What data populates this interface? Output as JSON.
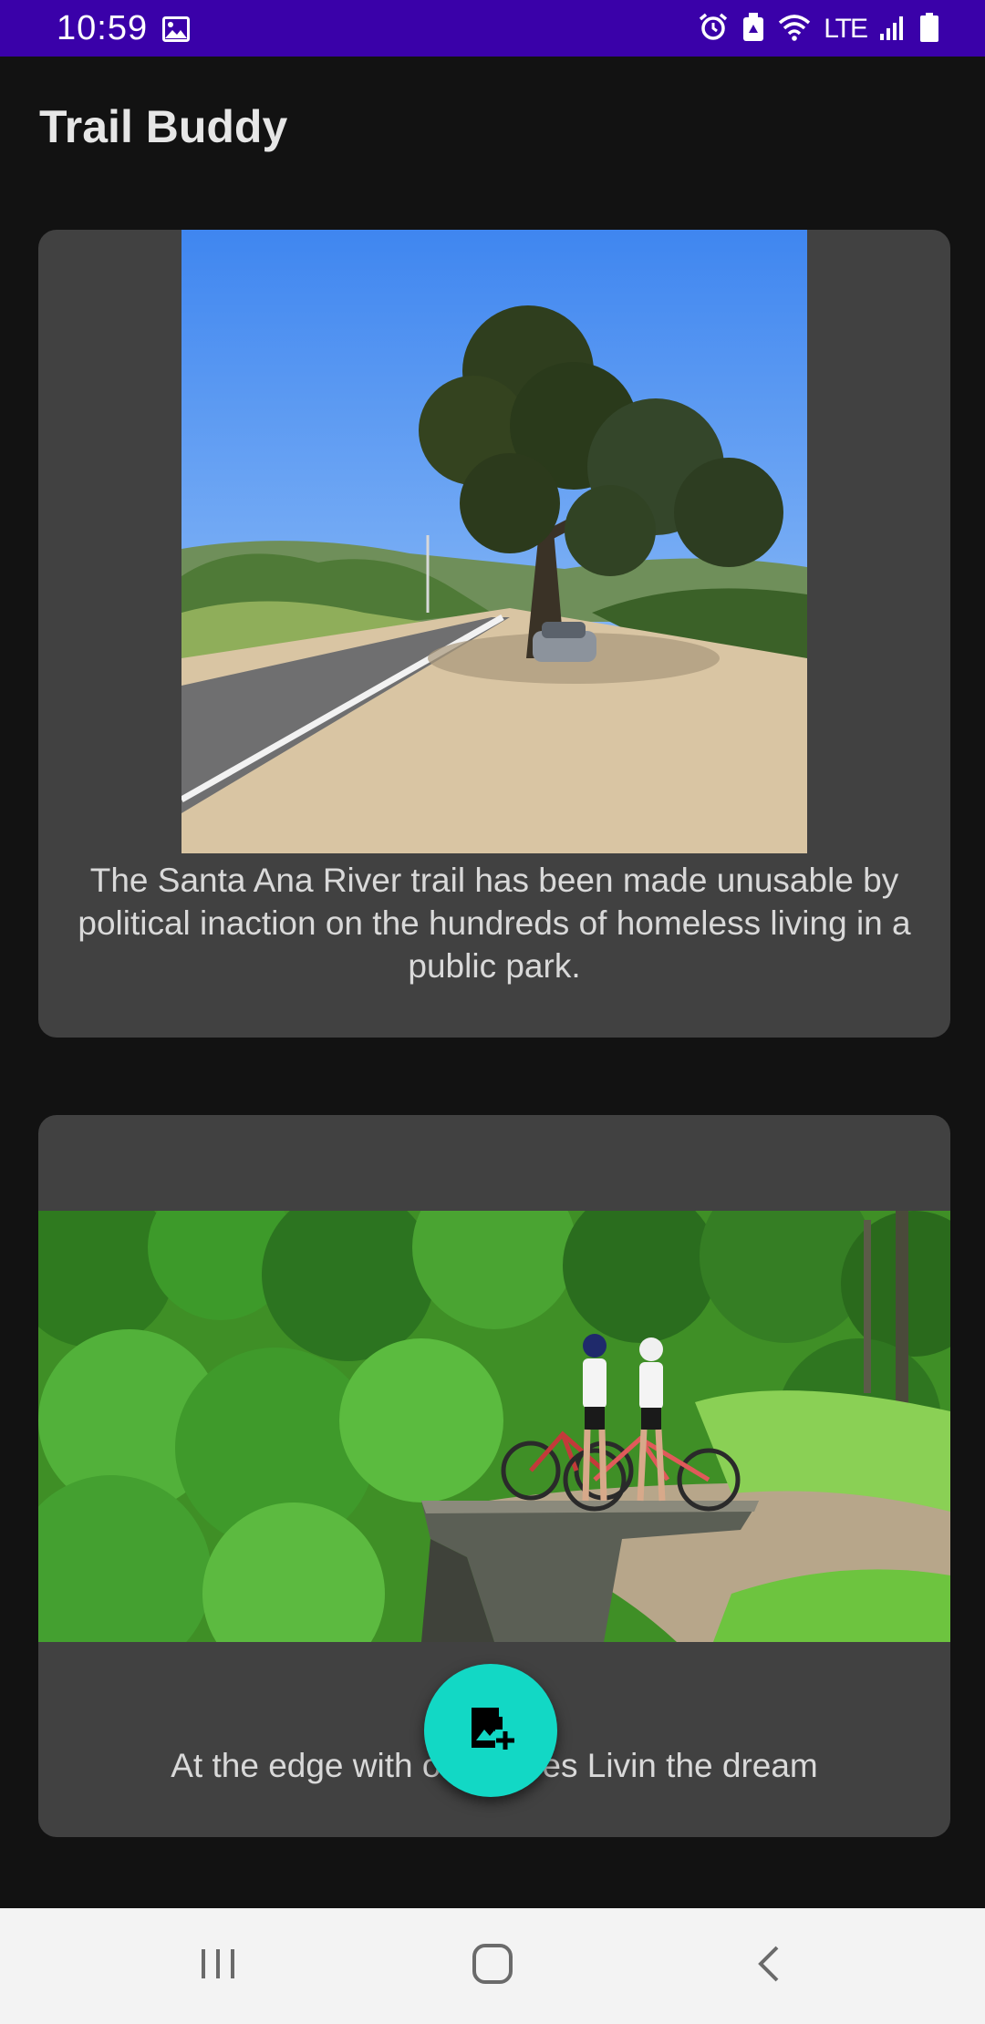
{
  "status_bar": {
    "time": "10:59",
    "network": "LTE",
    "icons": [
      "image-icon",
      "alarm-icon",
      "recycle-icon",
      "wifi-icon",
      "signal-icon",
      "battery-icon"
    ],
    "background": "#3a01a9"
  },
  "app_bar": {
    "title": "Trail Buddy"
  },
  "posts": [
    {
      "image": "road-trail-oak-tree-photo",
      "caption": "The Santa Ana River trail has been made unusable by political inaction on the hundreds of homeless living in a public park."
    },
    {
      "image": "cyclists-cliff-edge-photo",
      "caption": "At the edge with o   es Livin the dream"
    }
  ],
  "fab": {
    "icon": "add-photo-icon",
    "color": "#12d8c5"
  },
  "navigation_bar": {
    "buttons": [
      "recents-icon",
      "home-icon",
      "back-icon"
    ]
  }
}
